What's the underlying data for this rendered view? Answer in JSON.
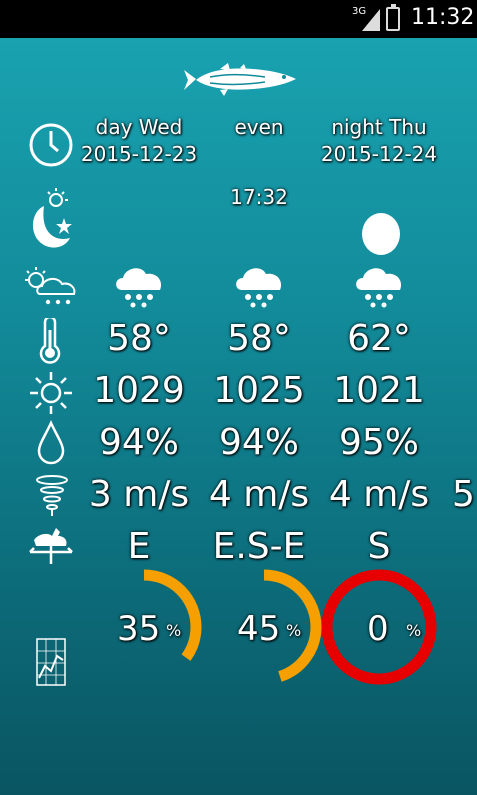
{
  "status_bar": {
    "network": "3G",
    "time": "11:32"
  },
  "icons": {
    "logo": "fish-logo",
    "rows": [
      "clock-icon",
      "moon-sun-icon",
      "weather-icon",
      "thermometer-icon",
      "sun-pressure-icon",
      "humidity-drop-icon",
      "wind-tornado-icon",
      "weathervane-icon",
      "chart-icon"
    ]
  },
  "periods": [
    {
      "label": "day Wed",
      "date": "2015-12-23"
    },
    {
      "label": "even",
      "date": ""
    },
    {
      "label": "night Thu",
      "date": "2015-12-24"
    }
  ],
  "moonrise_time": "17:32",
  "temperatures": [
    "58°",
    "58°",
    "62°"
  ],
  "pressures": [
    "1029",
    "1025",
    "1021"
  ],
  "humidity": [
    "94%",
    "94%",
    "95%"
  ],
  "wind_speed": [
    "3 m/s",
    "4 m/s",
    "4 m/s"
  ],
  "wind_overflow": "5",
  "wind_direction": [
    "E",
    "E.S-E",
    "S"
  ],
  "probability": [
    {
      "value": "35",
      "unit": "%",
      "fraction": 0.35,
      "color": "#f5a000"
    },
    {
      "value": "45",
      "unit": "%",
      "fraction": 0.45,
      "color": "#f5a000"
    },
    {
      "value": "0",
      "unit": "%",
      "fraction": 0,
      "color": "#e60000"
    }
  ],
  "colors": {
    "background_top": "#1aa5b3",
    "background_bottom": "#0a5562",
    "ring_orange": "#f5a000",
    "ring_red": "#e60000"
  }
}
